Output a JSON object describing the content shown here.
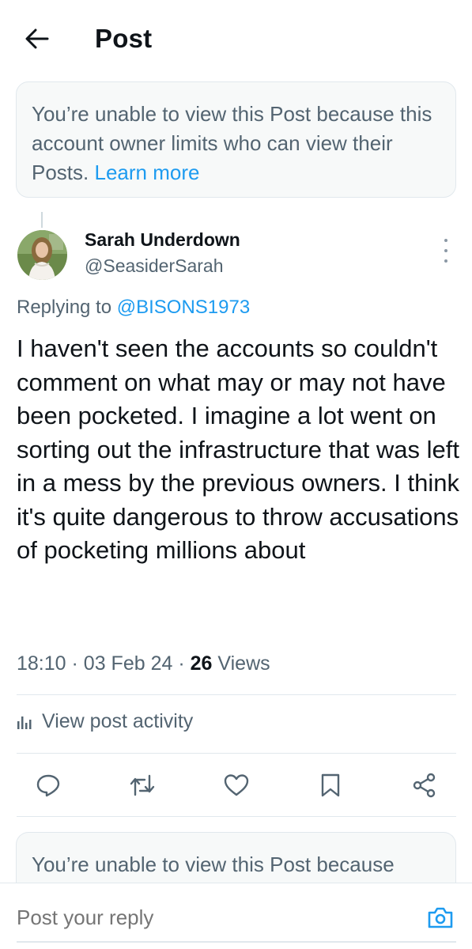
{
  "header": {
    "title": "Post",
    "back_icon": "arrow-left-icon"
  },
  "notice_top": {
    "text": "You’re unable to view this Post because this account owner limits who can view their Posts. ",
    "link": "Learn more"
  },
  "notice_bottom": {
    "text": "You’re unable to view this Post because"
  },
  "post": {
    "author_name": "Sarah Underdown",
    "author_handle": "@SeasiderSarah",
    "replying_prefix": "Replying to ",
    "replying_to": "@BISONS1973",
    "text": "I haven't seen the accounts so couldn't comment on what may or may not have been pocketed. I imagine a lot went on sorting out the infrastructure that was left in a mess by the previous owners. I think it's quite dangerous to throw accusations of pocketing millions about",
    "time": "18:10",
    "date": "03 Feb 24",
    "views_count": "26",
    "views_label": "Views",
    "separator": "·"
  },
  "activity": {
    "label": "View post activity"
  },
  "actions": [
    "reply-icon",
    "repost-icon",
    "like-icon",
    "bookmark-icon",
    "share-icon"
  ],
  "reply_bar": {
    "placeholder": "Post your reply"
  },
  "colors": {
    "accent": "#1d9bf0",
    "text_primary": "#0f1419",
    "text_secondary": "#536471",
    "notice_bg": "#f7f9f9",
    "border": "#e1e8ed"
  }
}
